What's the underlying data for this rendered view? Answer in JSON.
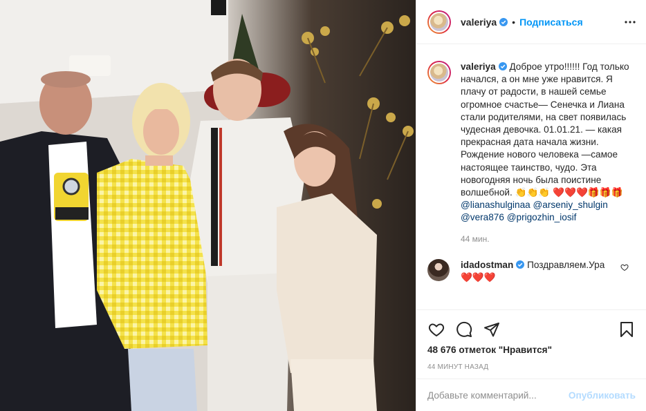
{
  "header": {
    "username": "valeriya",
    "separator": "•",
    "follow_label": "Подписаться"
  },
  "caption": {
    "username": "valeriya",
    "text": "Доброе утро!!!!!! Год только начался, а он мне уже нравится. Я плачу от радости, в нашей семье огромное счастье— Сенечка и Лиана стали родителями, на свет появилась чудесная девочка. 01.01.21. — какая прекрасная дата начала жизни. Рождение нового человека —самое настоящее таинство, чудо. Эта новогодняя ночь была поистине волшебной. 👏👏👏",
    "emoji_line": "❤️❤️❤️🎁🎁🎁",
    "mentions": [
      "@lianashulginaa",
      "@arseniy_shulgin",
      "@vera876",
      "@prigozhin_iosif"
    ],
    "time_ago": "44 мин."
  },
  "reply": {
    "username": "idadostman",
    "text": "Поздравляем.Ура",
    "emoji": "❤️❤️❤️"
  },
  "actions": {
    "likes": "48 676 отметок \"Нравится\"",
    "posted": "44 минут назад"
  },
  "comment_box": {
    "placeholder": "Добавьте комментарий...",
    "publish_label": "Опубликовать"
  },
  "icons": {
    "heart": "heart-icon",
    "comment": "comment-icon",
    "share": "share-icon",
    "save": "bookmark-icon",
    "more": "more-icon",
    "verified": "verified-badge-icon"
  },
  "colors": {
    "link_blue": "#0095f6",
    "publish_disabled": "#b3dbff",
    "mention": "#00376b",
    "verified": "#3897f0"
  }
}
